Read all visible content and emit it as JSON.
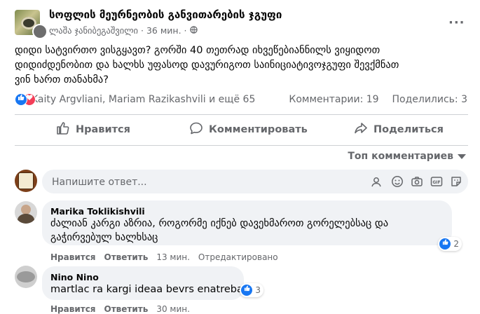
{
  "post": {
    "group_name": "სოფლის მეურნეობის განვითარების ჯგუფი",
    "author": "ლაშა ჯანიბეგაშვილი",
    "time": "36 мин.",
    "privacy_icon": "globe-icon",
    "more": "···",
    "text_lines": [
      "დიდი სატვირთო ვისგყავთ? გორში 40 თეთრად იხვეწებიანნილს ვიყიდოთ",
      "დიდიძდენობით და ხალხს უფასოდ დავურიგოთ საინიციატივოჯგუფი შევქმნათ",
      "ვინ ხართ თანახმა?"
    ]
  },
  "reactions": {
    "names": "Kaity Argvliani, Mariam Razikashvili и ещё 65",
    "comments_count": "Комментарии: 19",
    "shares_count": "Поделились: 3"
  },
  "actions": {
    "like": "Нравится",
    "comment": "Комментировать",
    "share": "Поделиться"
  },
  "sort_label": "Топ комментариев",
  "composer": {
    "placeholder": "Напишите ответ..."
  },
  "comments": [
    {
      "author": "Marika Toklikishvili",
      "lines": [
        "ძალიან კარგი აზრია, როგორმე იქნებ დავეხმაროთ გორელებსაც და",
        "გაჭირვებულ ხალხსაც"
      ],
      "like": "Нравится",
      "reply": "Ответить",
      "time": "13 мин.",
      "edited": "Отредактировано",
      "reactions": "2"
    },
    {
      "author": "Nino Nino",
      "lines": [
        "martlac ra kargi ideaa bevrs enatreba xili"
      ],
      "like": "Нравится",
      "reply": "Ответить",
      "time": "30 мин.",
      "reactions": "3"
    }
  ],
  "colors": {
    "accent": "#1877f2",
    "love": "#f33e58",
    "muted": "#65676b",
    "bubble": "#f0f2f5"
  }
}
